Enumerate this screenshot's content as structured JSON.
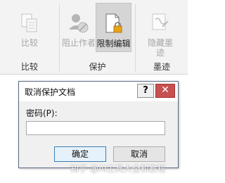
{
  "ribbon": {
    "compare_group": {
      "button_label": "比较",
      "group_label": "比较"
    },
    "protect_group": {
      "block_authors_label": "阻止作者",
      "restrict_editing_label": "限制编辑",
      "group_label": "保护"
    },
    "ink_group": {
      "hide_ink_label_line1": "隐藏墨",
      "hide_ink_label_line2": "迹",
      "group_label": "墨迹"
    }
  },
  "dialog": {
    "title": "取消保护文档",
    "help_label": "?",
    "close_label": "✕",
    "password_label": "密码(P):",
    "password_value": "",
    "ok_label": "确定",
    "cancel_label": "取消"
  },
  "watermark": "知乎 @AI工具大全和教程",
  "colors": {
    "ribbon_bg": "#f3f3f3",
    "close_red": "#c75050",
    "ok_border": "#3c7fb1"
  }
}
